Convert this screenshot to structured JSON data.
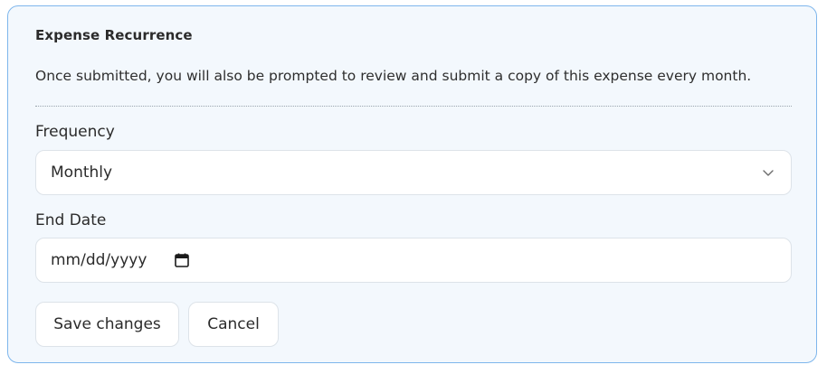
{
  "section": {
    "title": "Expense Recurrence",
    "description": "Once submitted, you will also be prompted to review and submit a copy of this expense every month."
  },
  "frequency": {
    "label": "Frequency",
    "selected": "Monthly",
    "icon": "chevron-down-icon"
  },
  "end_date": {
    "label": "End Date",
    "placeholder": "mm/dd/yyyy",
    "icon": "calendar-icon"
  },
  "actions": {
    "save_label": "Save changes",
    "cancel_label": "Cancel"
  },
  "colors": {
    "panel_border": "#7eb6ec",
    "panel_background": "#f3f8fd"
  }
}
